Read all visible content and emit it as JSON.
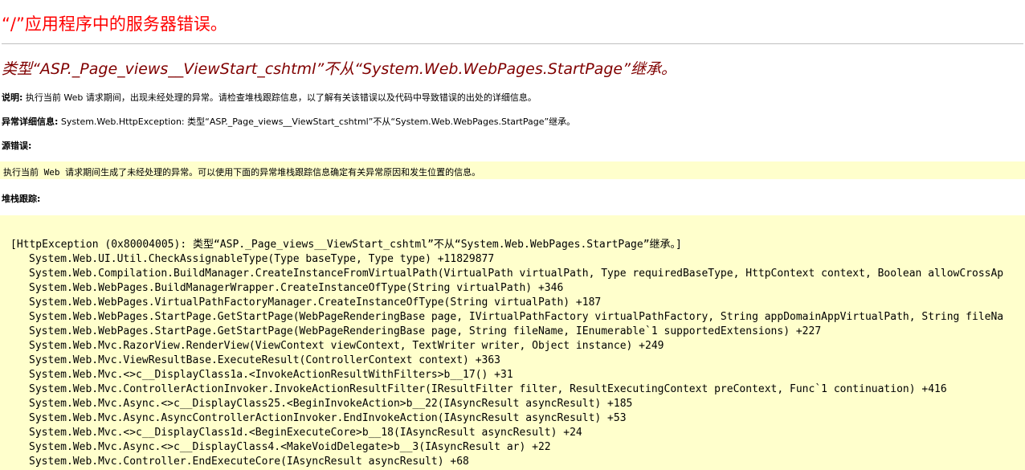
{
  "title": "“/”应用程序中的服务器错误。",
  "subtitle": "类型“ASP._Page_views__ViewStart_cshtml”不从“System.Web.WebPages.StartPage”继承。",
  "description": {
    "label": "说明:",
    "text": " 执行当前 Web 请求期间，出现未经处理的异常。请检查堆栈跟踪信息，以了解有关该错误以及代码中导致错误的出处的详细信息。"
  },
  "exception_details": {
    "label": "异常详细信息:",
    "text": " System.Web.HttpException: 类型“ASP._Page_views__ViewStart_cshtml”不从“System.Web.WebPages.StartPage”继承。"
  },
  "source_error": {
    "label": "源错误:",
    "text": "执行当前 Web 请求期间生成了未经处理的异常。可以使用下面的异常堆栈跟踪信息确定有关异常原因和发生位置的信息。"
  },
  "stack_trace": {
    "label": "堆栈跟踪:",
    "header": "[HttpException (0x80004005): 类型“ASP._Page_views__ViewStart_cshtml”不从“System.Web.WebPages.StartPage”继承。]",
    "lines": [
      "System.Web.UI.Util.CheckAssignableType(Type baseType, Type type) +11829877",
      "System.Web.Compilation.BuildManager.CreateInstanceFromVirtualPath(VirtualPath virtualPath, Type requiredBaseType, HttpContext context, Boolean allowCrossAp",
      "System.Web.WebPages.BuildManagerWrapper.CreateInstanceOfType(String virtualPath) +346",
      "System.Web.WebPages.VirtualPathFactoryManager.CreateInstanceOfType(String virtualPath) +187",
      "System.Web.WebPages.StartPage.GetStartPage(WebPageRenderingBase page, IVirtualPathFactory virtualPathFactory, String appDomainAppVirtualPath, String fileNa",
      "System.Web.WebPages.StartPage.GetStartPage(WebPageRenderingBase page, String fileName, IEnumerable`1 supportedExtensions) +227",
      "System.Web.Mvc.RazorView.RenderView(ViewContext viewContext, TextWriter writer, Object instance) +249",
      "System.Web.Mvc.ViewResultBase.ExecuteResult(ControllerContext context) +363",
      "System.Web.Mvc.<>c__DisplayClass1a.<InvokeActionResultWithFilters>b__17() +31",
      "System.Web.Mvc.ControllerActionInvoker.InvokeActionResultFilter(IResultFilter filter, ResultExecutingContext preContext, Func`1 continuation) +416",
      "System.Web.Mvc.Async.<>c__DisplayClass25.<BeginInvokeAction>b__22(IAsyncResult asyncResult) +185",
      "System.Web.Mvc.Async.AsyncControllerActionInvoker.EndInvokeAction(IAsyncResult asyncResult) +53",
      "System.Web.Mvc.<>c__DisplayClass1d.<BeginExecuteCore>b__18(IAsyncResult asyncResult) +24",
      "System.Web.Mvc.Async.<>c__DisplayClass4.<MakeVoidDelegate>b__3(IAsyncResult ar) +22",
      "System.Web.Mvc.Controller.EndExecuteCore(IAsyncResult asyncResult) +68"
    ]
  },
  "colors": {
    "title": "#ff0000",
    "subtitle": "#800000",
    "box_background": "#ffffcc",
    "rule": "#c0c0c0"
  }
}
